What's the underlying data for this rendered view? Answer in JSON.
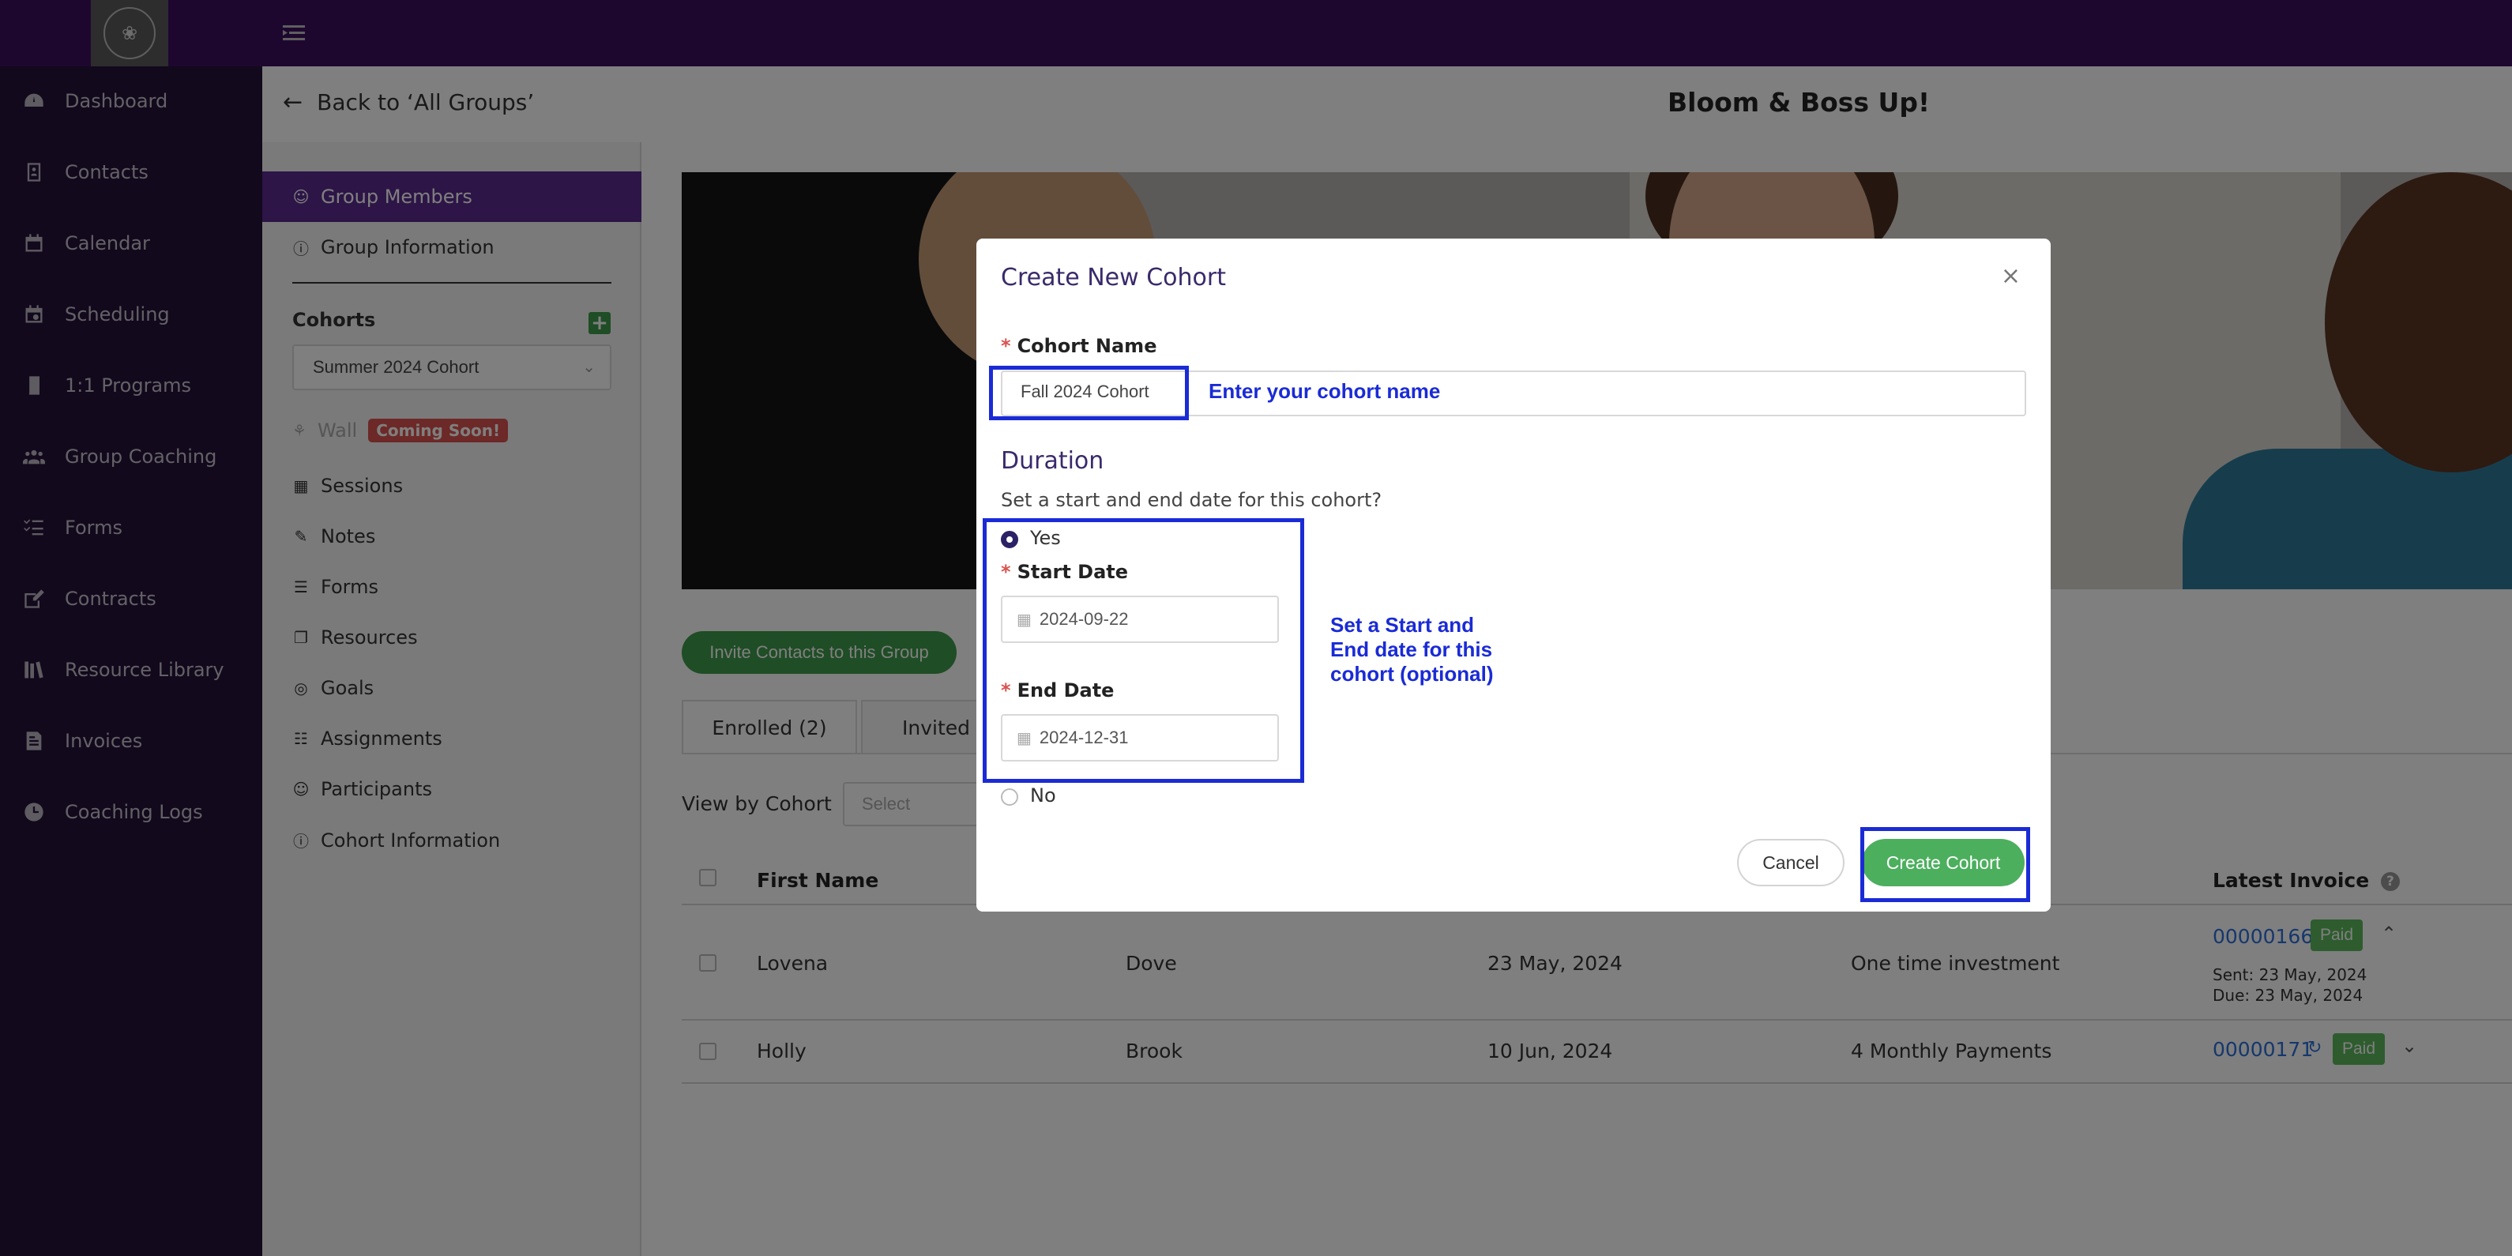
{
  "sidebar": {
    "items": [
      {
        "label": "Dashboard",
        "icon": "dashboard-icon"
      },
      {
        "label": "Contacts",
        "icon": "contacts-icon"
      },
      {
        "label": "Calendar",
        "icon": "calendar-icon"
      },
      {
        "label": "Scheduling",
        "icon": "scheduling-icon"
      },
      {
        "label": "1:1 Programs",
        "icon": "book-icon"
      },
      {
        "label": "Group Coaching",
        "icon": "group-icon"
      },
      {
        "label": "Forms",
        "icon": "forms-icon"
      },
      {
        "label": "Contracts",
        "icon": "contract-icon"
      },
      {
        "label": "Resource Library",
        "icon": "library-icon"
      },
      {
        "label": "Invoices",
        "icon": "invoice-icon"
      },
      {
        "label": "Coaching Logs",
        "icon": "clock-icon"
      }
    ]
  },
  "header": {
    "back_label": "Back to ‘All Groups’",
    "group_title": "Bloom & Boss Up!"
  },
  "group_menu": {
    "members": "Group Members",
    "information": "Group Information",
    "cohorts_label": "Cohorts",
    "cohort_selected": "Summer 2024 Cohort",
    "wall": "Wall",
    "coming_soon": "Coming Soon!",
    "links": [
      "Sessions",
      "Notes",
      "Forms",
      "Resources",
      "Goals",
      "Assignments",
      "Participants",
      "Cohort Information"
    ]
  },
  "members": {
    "invite_button": "Invite Contacts to this Group",
    "tabs": [
      "Enrolled (2)",
      "Invited ("
    ],
    "view_by_label": "View by Cohort",
    "view_select_placeholder": "Select",
    "columns": {
      "first_name": "First Name",
      "latest_invoice": "Latest Invoice"
    },
    "rows": [
      {
        "first": "Lovena",
        "last": "Dove",
        "date": "23 May, 2024",
        "plan": "One time investment",
        "invoice": "00000166",
        "status": "Paid",
        "sent": "Sent: 23 May, 2024",
        "due": "Due: 23 May, 2024"
      },
      {
        "first": "Holly",
        "last": "Brook",
        "date": "10 Jun, 2024",
        "plan": "4 Monthly Payments",
        "invoice": "00000171",
        "status": "Paid"
      }
    ]
  },
  "modal": {
    "title": "Create New Cohort",
    "cohort_name_label": "Cohort Name",
    "cohort_name_value": "Fall 2024 Cohort",
    "duration_title": "Duration",
    "duration_question": "Set a start and end date for this cohort?",
    "yes_label": "Yes",
    "no_label": "No",
    "start_label": "Start Date",
    "start_value": "2024-09-22",
    "end_label": "End Date",
    "end_value": "2024-12-31",
    "cancel_label": "Cancel",
    "create_label": "Create Cohort"
  },
  "annotations": {
    "name_hint": "Enter your cohort name",
    "date_hint_1": "Set a Start and",
    "date_hint_2": "End date for this",
    "date_hint_3": "cohort (optional)"
  },
  "colors": {
    "topbar": "#3a0f5e",
    "sidebar": "#25123a",
    "accent_purple": "#5b2b8f",
    "green": "#4caf5e",
    "annotation_blue": "#1a2bd6"
  }
}
